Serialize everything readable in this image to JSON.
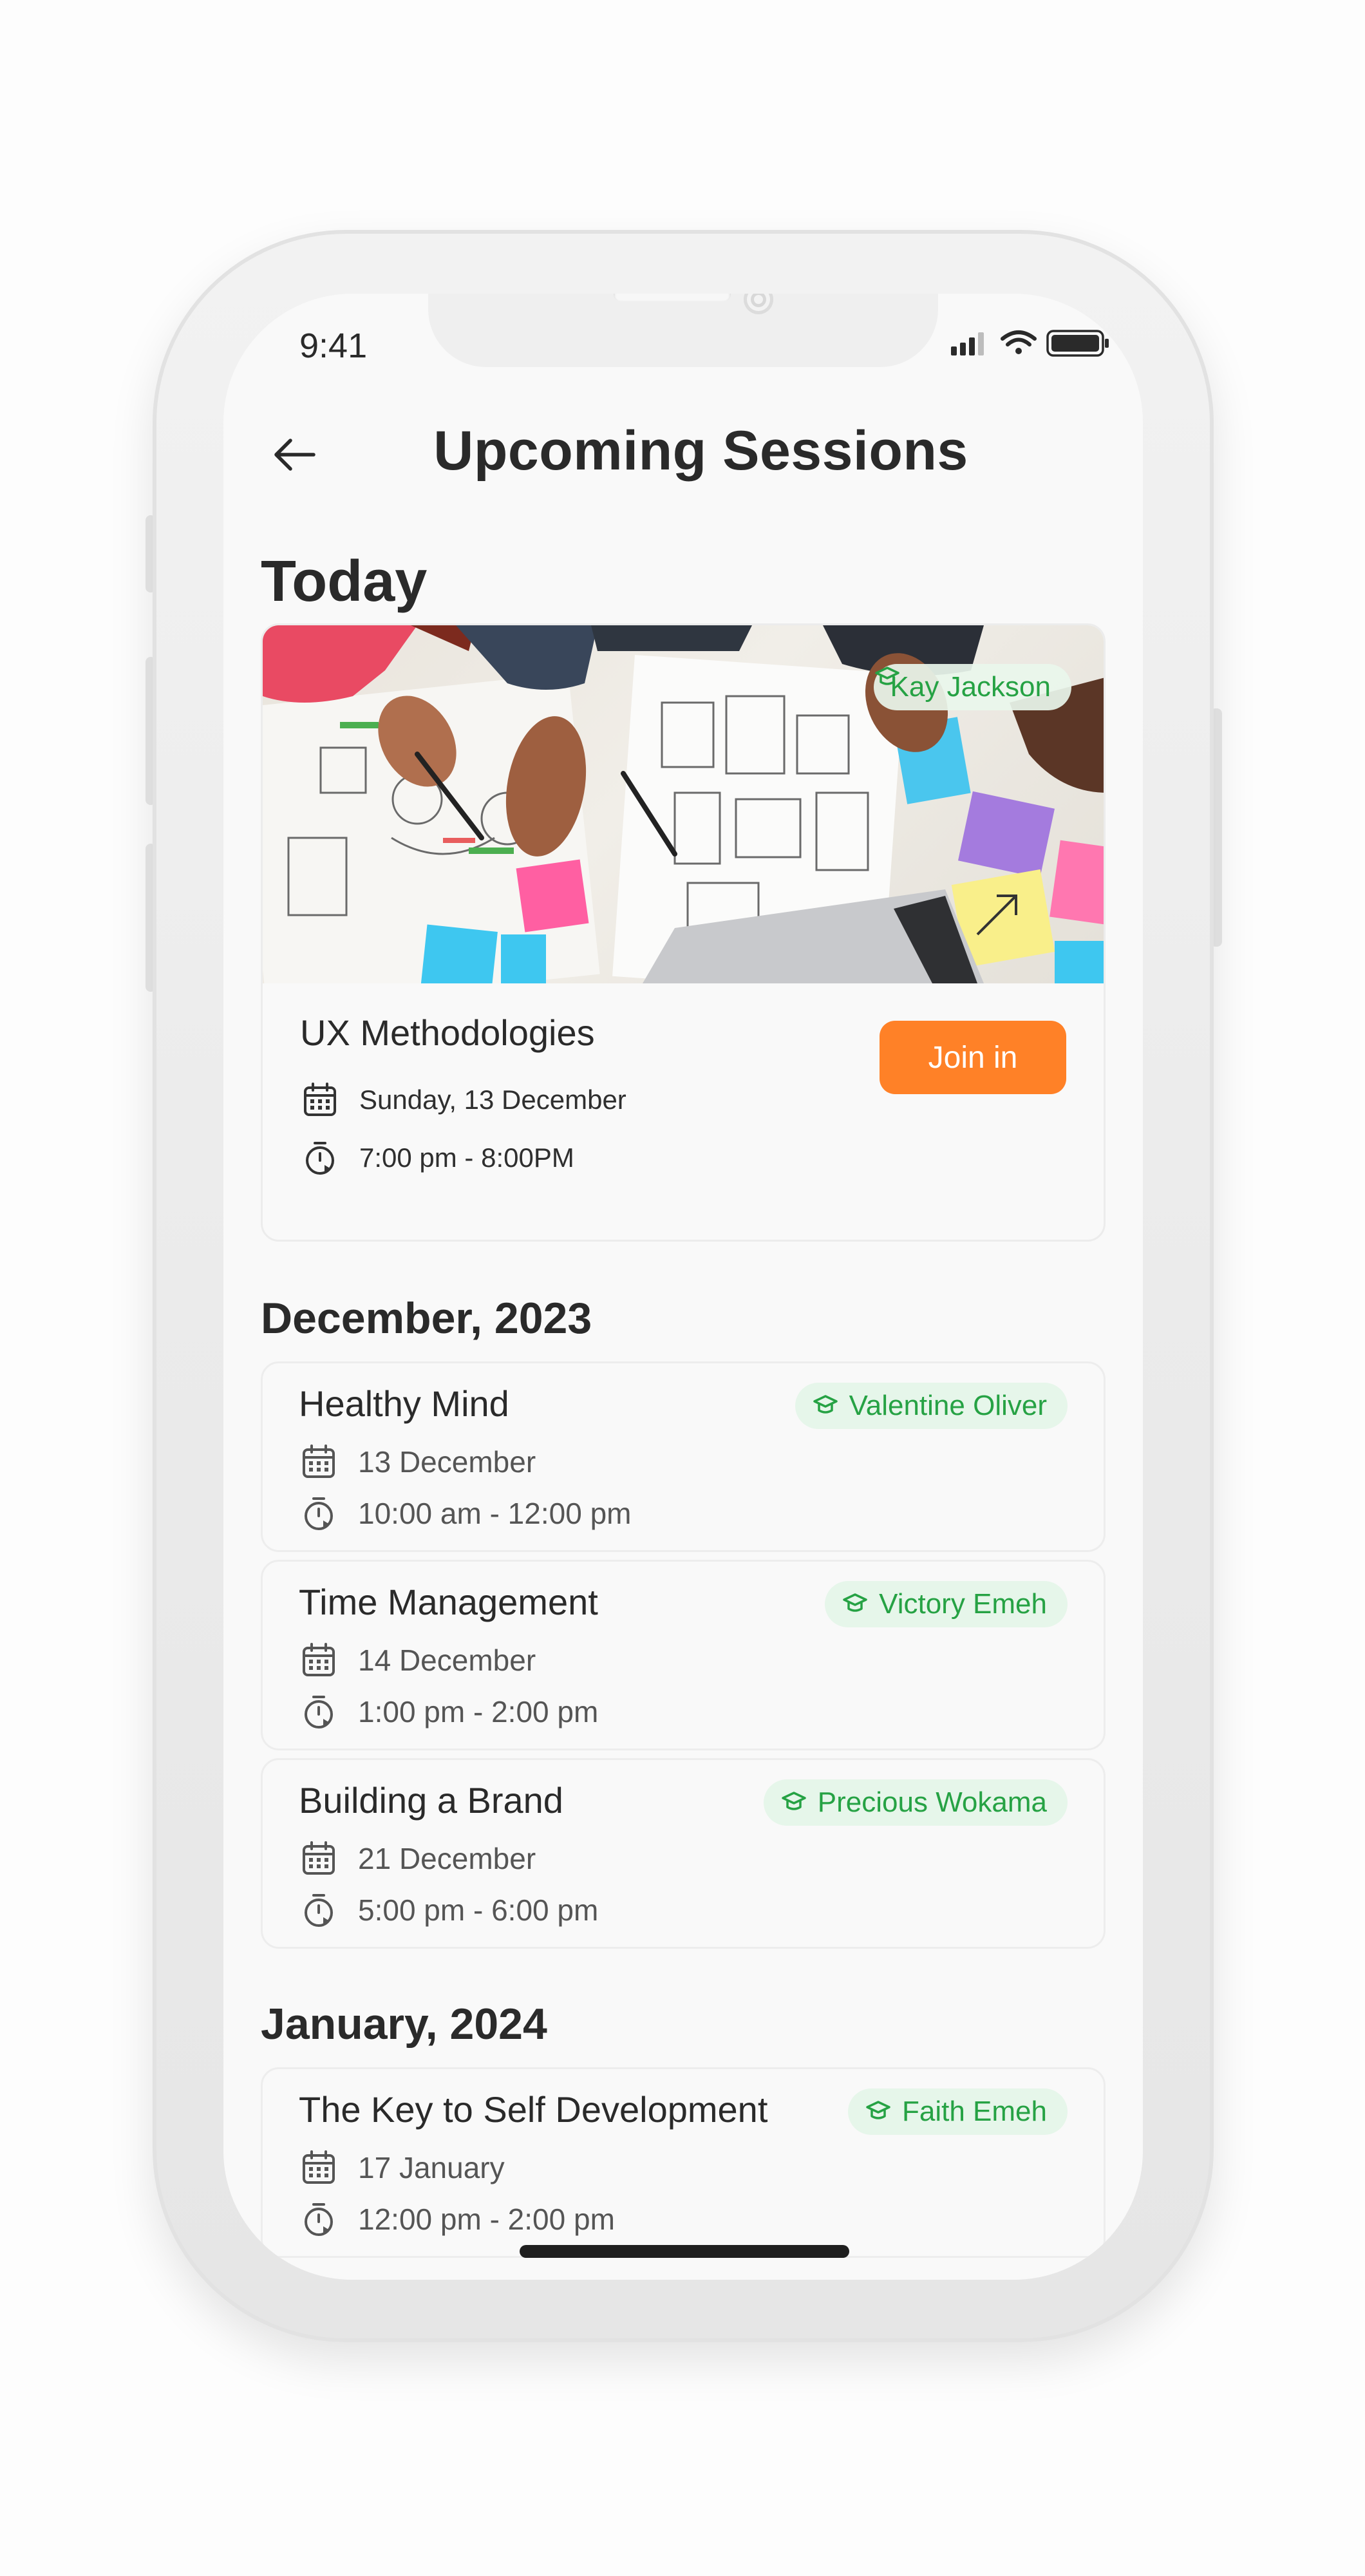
{
  "status": {
    "time": "9:41"
  },
  "header": {
    "title": "Upcoming Sessions"
  },
  "today": {
    "heading": "Today",
    "featured": {
      "mentor": "Kay Jackson",
      "title": "UX Methodologies",
      "join_label": "Join in",
      "date": "Sunday, 13 December",
      "time": "7:00 pm - 8:00PM"
    }
  },
  "december": {
    "heading": "December, 2023",
    "sessions": [
      {
        "title": "Healthy Mind",
        "mentor": "Valentine Oliver",
        "date": "13 December",
        "time": "10:00 am - 12:00 pm"
      },
      {
        "title": "Time Management",
        "mentor": "Victory Emeh",
        "date": "14 December",
        "time": "1:00 pm - 2:00 pm"
      },
      {
        "title": "Building a Brand",
        "mentor": "Precious Wokama",
        "date": "21 December",
        "time": "5:00 pm - 6:00 pm"
      }
    ]
  },
  "january": {
    "heading": "January, 2024",
    "sessions": [
      {
        "title": "The Key to Self Development",
        "mentor": "Faith Emeh",
        "date": "17 January",
        "time": "12:00 pm - 2:00 pm"
      }
    ]
  },
  "colors": {
    "accent": "#ff8127",
    "mentor_green": "#26a244",
    "chip_bg": "#e6f6ea"
  },
  "icons": {
    "back": "arrow-left-icon",
    "mentor": "graduation-cap-icon",
    "date": "calendar-icon",
    "time": "timer-icon"
  }
}
